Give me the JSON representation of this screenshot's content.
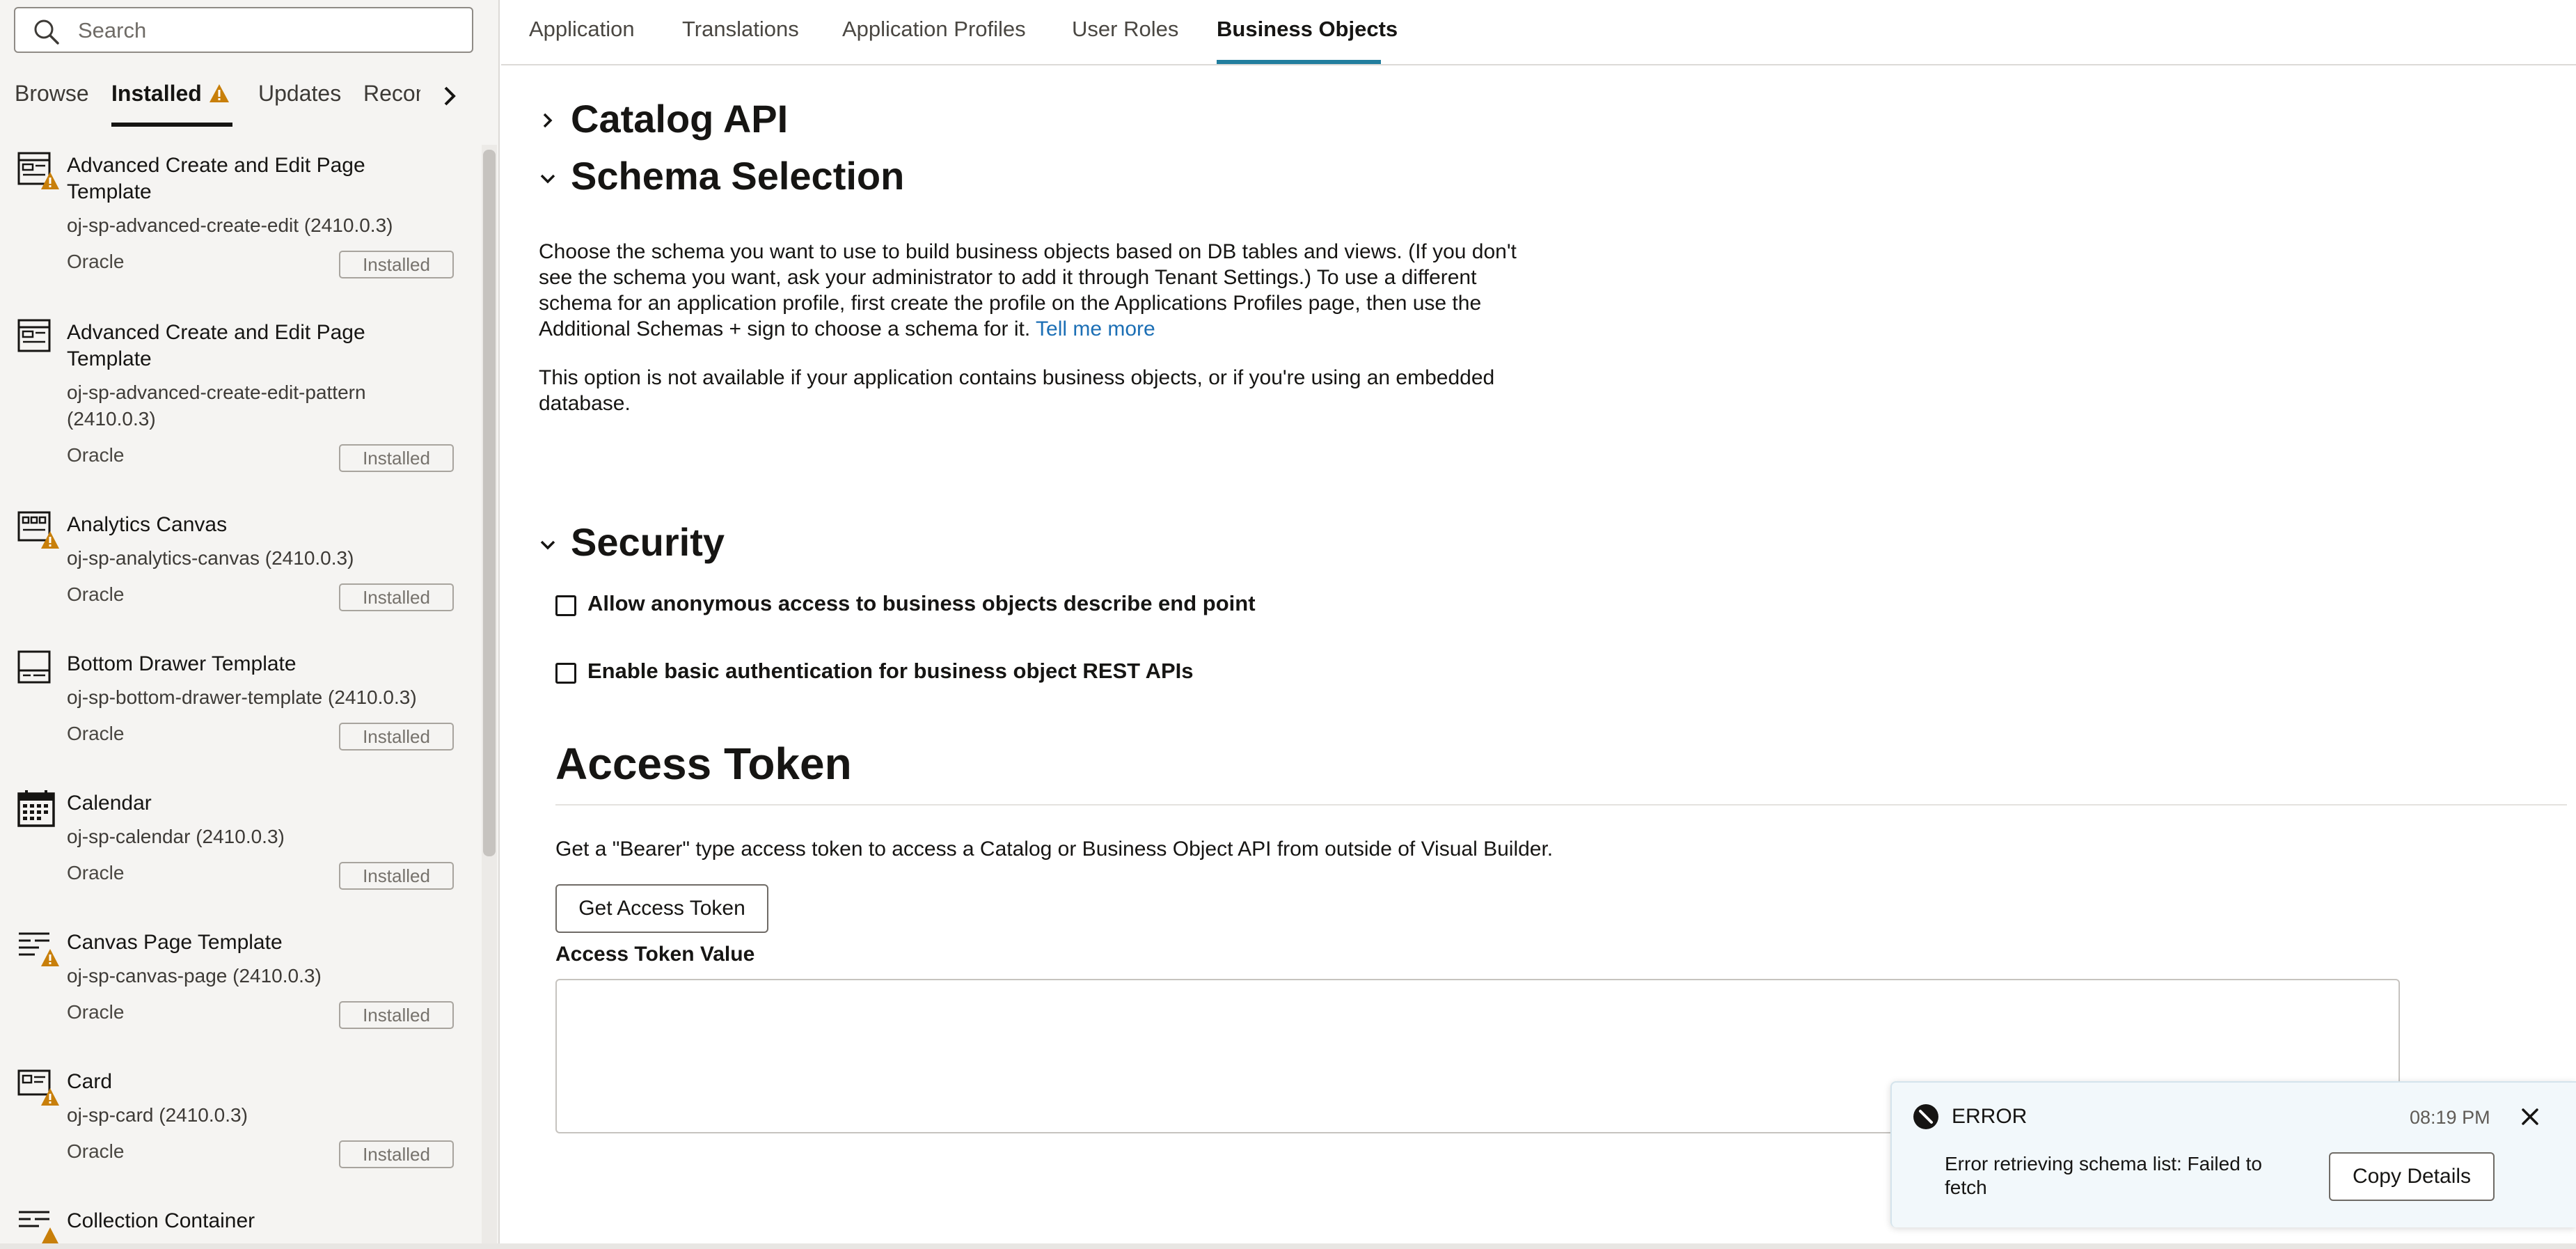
{
  "sidebar": {
    "search": {
      "placeholder": "Search",
      "value": ""
    },
    "tabs": [
      {
        "label": "Browse",
        "active": false
      },
      {
        "label": "Installed",
        "active": true,
        "icon": "warning-icon"
      },
      {
        "label": "Updates",
        "active": false
      },
      {
        "label": "Recommended",
        "active": false
      }
    ],
    "components": [
      {
        "title": "Advanced Create and Edit Page Template",
        "id": "oj-sp-advanced-create-edit (2410.0.3)",
        "vendor": "Oracle",
        "status": "Installed",
        "icon": "page-template-icon",
        "warning": true
      },
      {
        "title": "Advanced Create and Edit Page Template",
        "id": "oj-sp-advanced-create-edit-pattern (2410.0.3)",
        "vendor": "Oracle",
        "status": "Installed",
        "icon": "page-template-icon",
        "warning": false
      },
      {
        "title": "Analytics Canvas",
        "id": "oj-sp-analytics-canvas (2410.0.3)",
        "vendor": "Oracle",
        "status": "Installed",
        "icon": "analytics-icon",
        "warning": true
      },
      {
        "title": "Bottom Drawer Template",
        "id": "oj-sp-bottom-drawer-template (2410.0.3)",
        "vendor": "Oracle",
        "status": "Installed",
        "icon": "drawer-icon",
        "warning": false
      },
      {
        "title": "Calendar",
        "id": "oj-sp-calendar (2410.0.3)",
        "vendor": "Oracle",
        "status": "Installed",
        "icon": "calendar-icon",
        "warning": false
      },
      {
        "title": "Canvas Page Template",
        "id": "oj-sp-canvas-page (2410.0.3)",
        "vendor": "Oracle",
        "status": "Installed",
        "icon": "canvas-icon",
        "warning": true
      },
      {
        "title": "Card",
        "id": "oj-sp-card (2410.0.3)",
        "vendor": "Oracle",
        "status": "Installed",
        "icon": "card-icon",
        "warning": true
      },
      {
        "title": "Collection Container",
        "icon": "collection-icon",
        "warning": true
      }
    ]
  },
  "main": {
    "tabs": [
      {
        "label": "Application",
        "active": false
      },
      {
        "label": "Translations",
        "active": false
      },
      {
        "label": "Application Profiles",
        "active": false
      },
      {
        "label": "User Roles",
        "active": false
      },
      {
        "label": "Business Objects",
        "active": true
      }
    ],
    "catalog": {
      "title": "Catalog API",
      "expanded": false
    },
    "schema": {
      "title": "Schema Selection",
      "expanded": true,
      "paragraph": "Choose the schema you want to use to build business objects based on DB tables and views. (If you don't see the schema you want, ask your administrator to add it through Tenant Settings.) To use a different schema for an application profile, first create the profile on the Applications Profiles page, then use the Additional Schemas + sign to choose a schema for it.",
      "link": "Tell me more",
      "paragraph2": "This option is not available if your application contains business objects, or if you're using an embedded database."
    },
    "security": {
      "title": "Security",
      "expanded": true,
      "anon_label": "Allow anonymous access to business objects describe end point",
      "anon_checked": false,
      "basic_label": "Enable basic authentication for business object REST APIs",
      "basic_checked": false
    },
    "token": {
      "title": "Access Token",
      "description": "Get a \"Bearer\" type access token to access a Catalog or Business Object API from outside of Visual Builder.",
      "button": "Get Access Token",
      "value_label": "Access Token Value",
      "value": ""
    }
  },
  "toast": {
    "title": "ERROR",
    "time": "08:19 PM",
    "message": "Error retrieving schema list: Failed to fetch",
    "button": "Copy Details"
  },
  "colors": {
    "accent": "#227e9e",
    "link": "#1c6fb5",
    "warning": "#c87f0a",
    "error": "#161513"
  }
}
